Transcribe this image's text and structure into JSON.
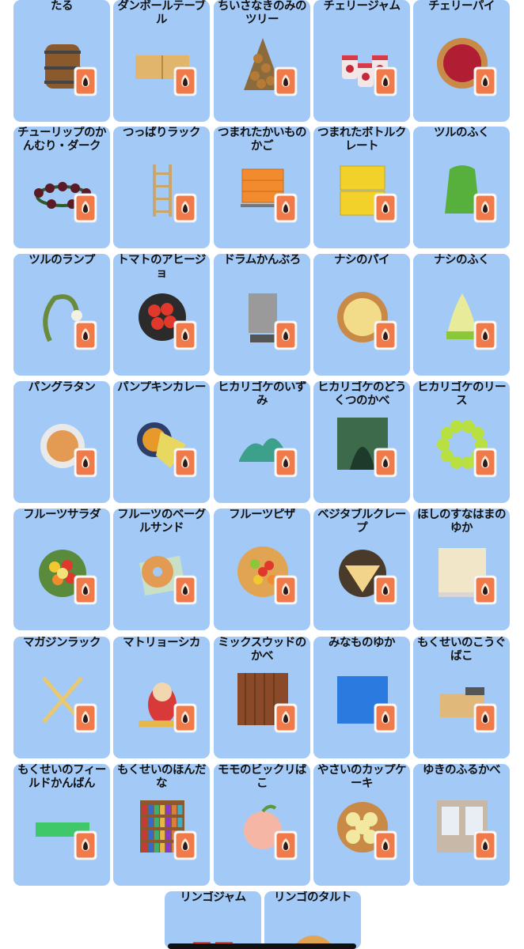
{
  "items": [
    {
      "label": "たる",
      "icon": "barrel-icon"
    },
    {
      "label": "ダンボールテーブル",
      "icon": "cardboard-table-icon"
    },
    {
      "label": "ちいさなきのみのツリー",
      "icon": "small-nut-tree-icon"
    },
    {
      "label": "チェリージャム",
      "icon": "cherry-jam-icon"
    },
    {
      "label": "チェリーパイ",
      "icon": "cherry-pie-icon"
    },
    {
      "label": "チューリップのかんむり・ダーク",
      "icon": "tulip-crown-icon"
    },
    {
      "label": "つっぱりラック",
      "icon": "tension-rack-icon"
    },
    {
      "label": "つまれたかいものかご",
      "icon": "stacked-baskets-icon"
    },
    {
      "label": "つまれたボトルクレート",
      "icon": "bottle-crate-icon"
    },
    {
      "label": "ツルのふく",
      "icon": "vine-outfit-icon"
    },
    {
      "label": "ツルのランプ",
      "icon": "vine-lamp-icon"
    },
    {
      "label": "トマトのアヒージョ",
      "icon": "tomato-ajillo-icon"
    },
    {
      "label": "ドラムかんぶろ",
      "icon": "drum-bath-icon"
    },
    {
      "label": "ナシのパイ",
      "icon": "pear-pie-icon"
    },
    {
      "label": "ナシのふく",
      "icon": "pear-dress-icon"
    },
    {
      "label": "パングラタン",
      "icon": "bread-gratin-icon"
    },
    {
      "label": "パンプキンカレー",
      "icon": "pumpkin-curry-icon"
    },
    {
      "label": "ヒカリゴケのいずみ",
      "icon": "moss-fountain-icon"
    },
    {
      "label": "ヒカリゴケのどうくつのかべ",
      "icon": "moss-cave-wall-icon"
    },
    {
      "label": "ヒカリゴケのリース",
      "icon": "moss-wreath-icon"
    },
    {
      "label": "フルーツサラダ",
      "icon": "fruit-salad-icon"
    },
    {
      "label": "フルーツのベーグルサンド",
      "icon": "bagel-sandwich-icon"
    },
    {
      "label": "フルーツピザ",
      "icon": "fruit-pizza-icon"
    },
    {
      "label": "ベジタブルクレープ",
      "icon": "vegetable-crepe-icon"
    },
    {
      "label": "ほしのすなはまのゆか",
      "icon": "star-sand-floor-icon"
    },
    {
      "label": "マガジンラック",
      "icon": "magazine-rack-icon"
    },
    {
      "label": "マトリョーシカ",
      "icon": "matryoshka-icon"
    },
    {
      "label": "ミックスウッドのかべ",
      "icon": "mixed-wood-wall-icon"
    },
    {
      "label": "みなものゆか",
      "icon": "water-surface-floor-icon"
    },
    {
      "label": "もくせいのこうぐばこ",
      "icon": "wooden-toolbox-icon"
    },
    {
      "label": "もくせいのフィールドかんばん",
      "icon": "wooden-field-sign-icon"
    },
    {
      "label": "もくせいのほんだな",
      "icon": "wooden-bookshelf-icon"
    },
    {
      "label": "モモのビックリばこ",
      "icon": "peach-surprise-box-icon"
    },
    {
      "label": "やさいのカップケーキ",
      "icon": "veggie-cupcake-icon"
    },
    {
      "label": "ゆきのふるかべ",
      "icon": "snowy-wall-icon"
    },
    {
      "label": "リンゴジャム",
      "icon": "apple-jam-icon"
    },
    {
      "label": "リンゴのタルト",
      "icon": "apple-tart-icon"
    }
  ],
  "colors": {
    "card_bg": "#a3c9f7",
    "badge_orange": "#f07a4a",
    "badge_border": "#ffffff"
  }
}
